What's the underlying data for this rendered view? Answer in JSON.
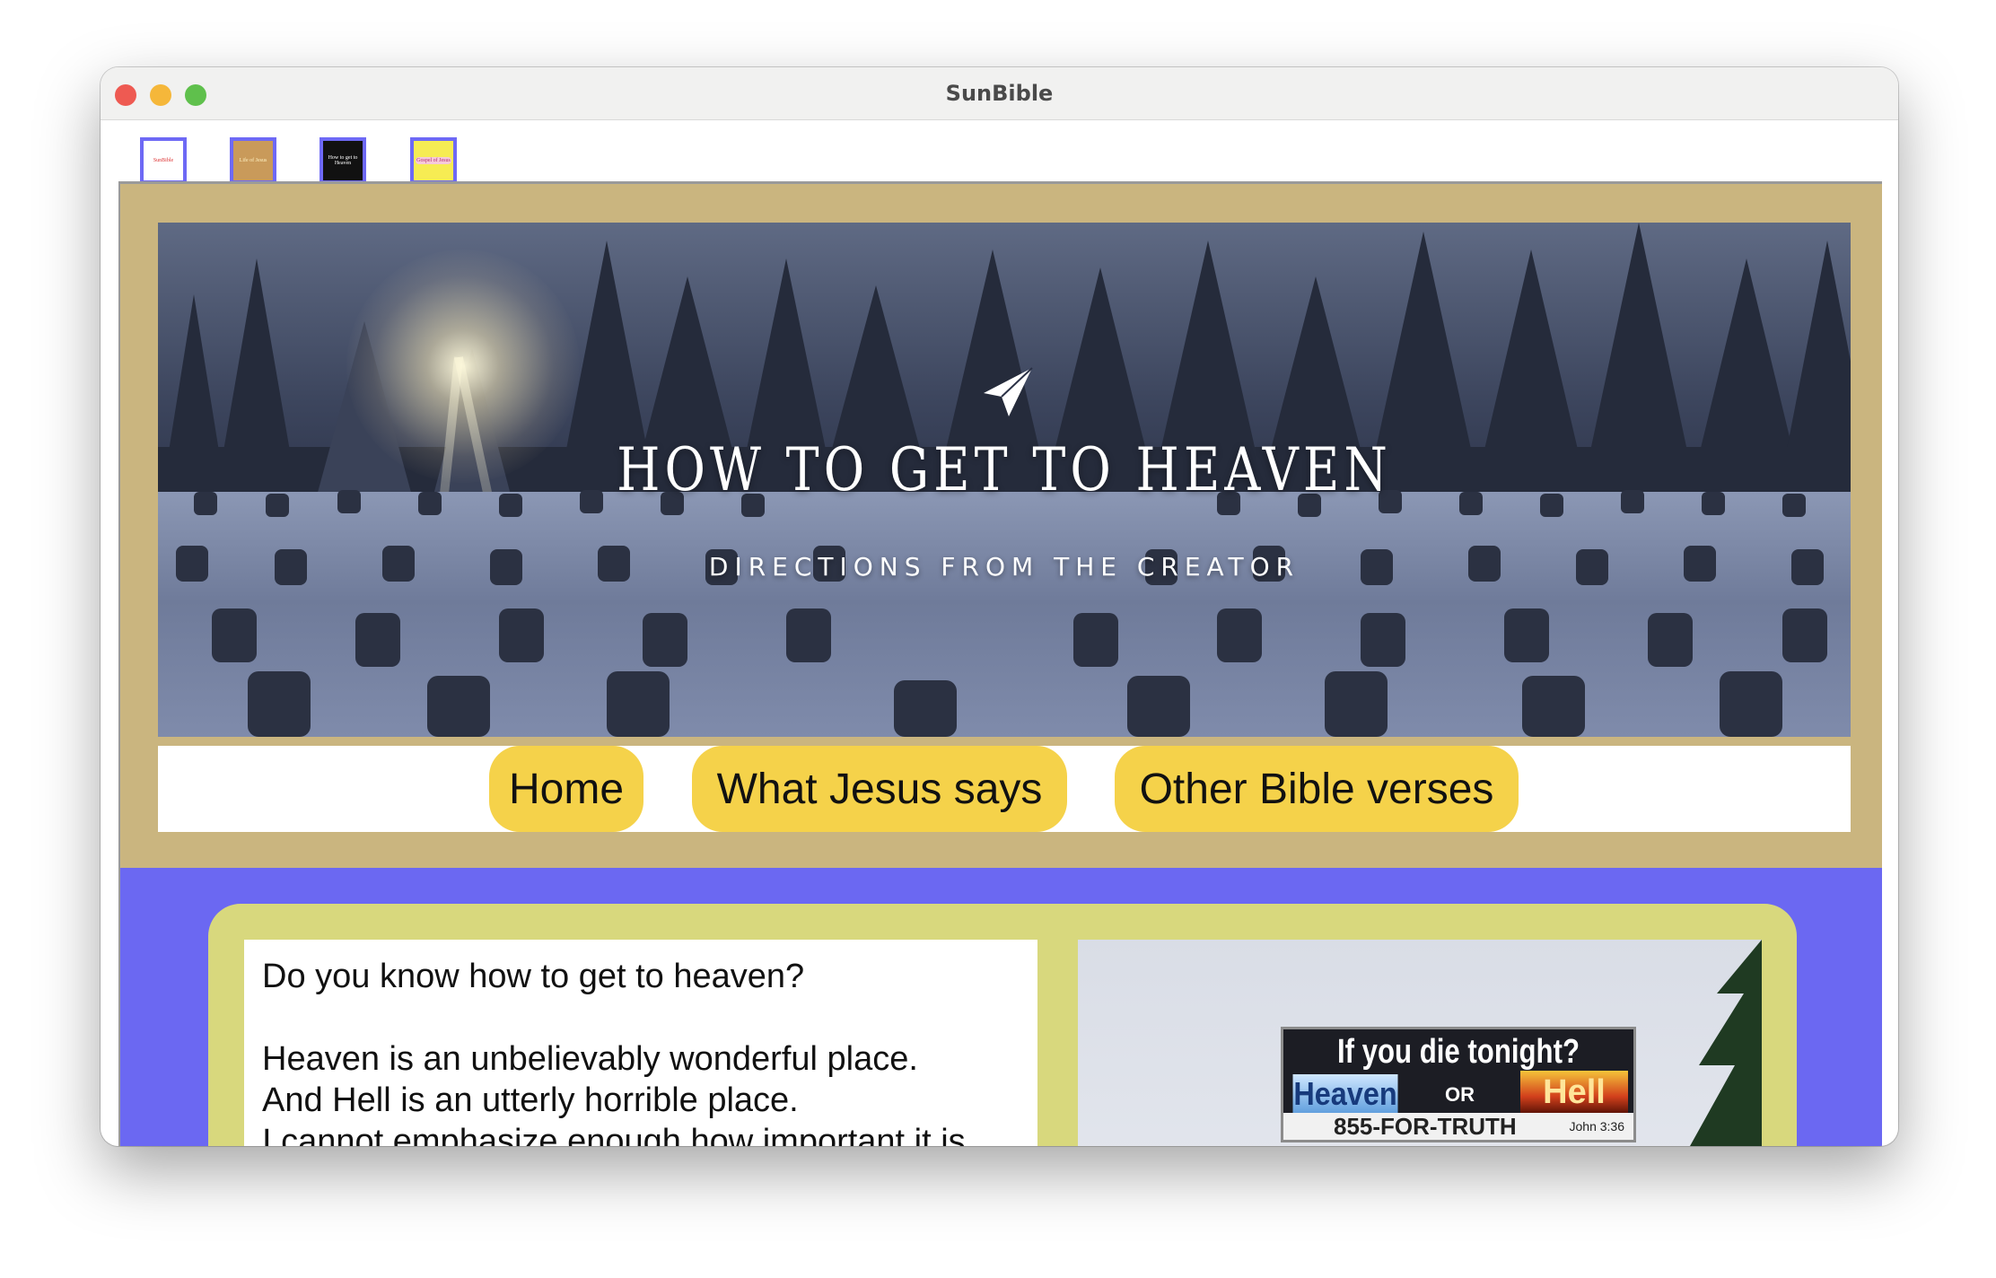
{
  "window": {
    "title": "SunBible"
  },
  "tabs": [
    {
      "label": "SunBible"
    },
    {
      "label": "Life of Jesus"
    },
    {
      "label": "How to get to Heaven"
    },
    {
      "label": "Gospel of Jesus"
    }
  ],
  "hero": {
    "title": "HOW TO GET TO HEAVEN",
    "subtitle": "DIRECTIONS FROM THE CREATOR",
    "icon": "paper-plane-icon"
  },
  "nav": {
    "items": [
      {
        "label": "Home"
      },
      {
        "label": "What Jesus says"
      },
      {
        "label": "Other Bible verses"
      }
    ]
  },
  "content": {
    "line1": "Do you know how to get to heaven?",
    "line2": "Heaven is an unbelievably wonderful place.",
    "line3": "And Hell is an utterly horrible place.",
    "line4": "I cannot emphasize enough how important it is"
  },
  "billboard": {
    "headline": "If you die tonight?",
    "heaven": "Heaven",
    "or": "OR",
    "hell": "Hell",
    "phone": "855-FOR-TRUTH",
    "reference": "John 3:36"
  },
  "colors": {
    "page_bg": "#cab57f",
    "accent": "#6b68f2",
    "nav_button": "#f5d24a",
    "card": "#d8d87d"
  }
}
